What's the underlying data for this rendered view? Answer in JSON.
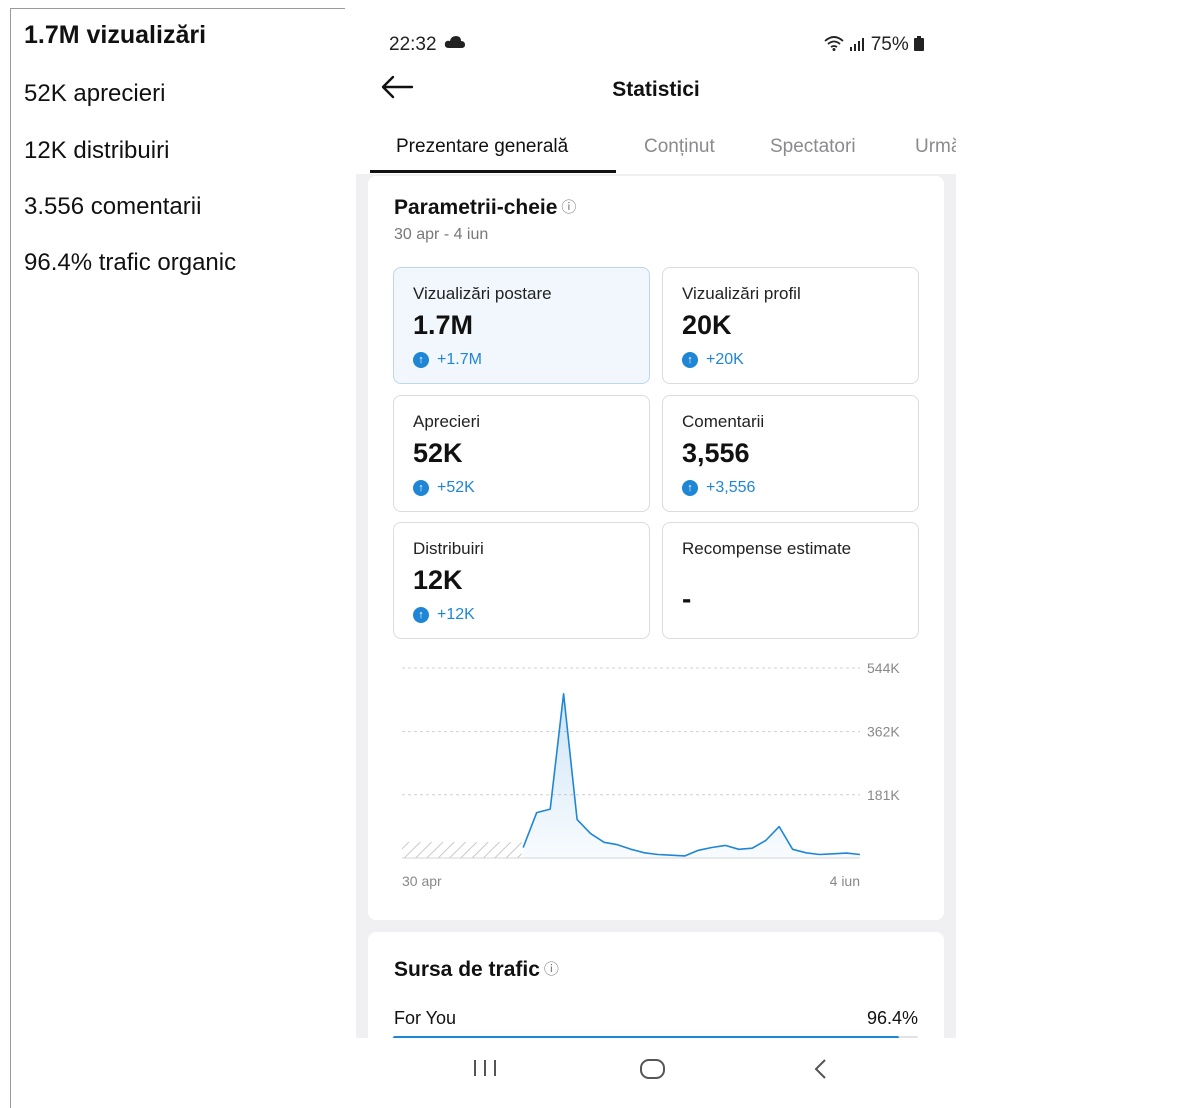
{
  "summary": {
    "views": "1.7M vizualizări",
    "likes": "52K aprecieri",
    "shares": "12K distribuiri",
    "comments": "3.556 comentarii",
    "organic": "96.4% trafic organic"
  },
  "status_bar": {
    "time": "22:32",
    "battery": "75%",
    "icons": [
      "cloud-icon",
      "wifi-icon",
      "signal-icon",
      "battery-icon"
    ]
  },
  "header": {
    "title": "Statistici",
    "back_icon": "back-arrow-icon"
  },
  "tabs": [
    {
      "label": "Prezentare generală",
      "active": true
    },
    {
      "label": "Conținut",
      "active": false
    },
    {
      "label": "Spectatori",
      "active": false
    },
    {
      "label": "Urmăritori",
      "active": false
    }
  ],
  "key_metrics": {
    "title": "Parametrii-cheie",
    "info_icon": "ⓘ",
    "date_range": "30 apr - 4 iun",
    "tiles": [
      {
        "label": "Vizualizări postare",
        "value": "1.7M",
        "delta": "+1.7M",
        "selected": true
      },
      {
        "label": "Vizualizări profil",
        "value": "20K",
        "delta": "+20K",
        "selected": false
      },
      {
        "label": "Aprecieri",
        "value": "52K",
        "delta": "+52K",
        "selected": false
      },
      {
        "label": "Comentarii",
        "value": "3,556",
        "delta": "+3,556",
        "selected": false
      },
      {
        "label": "Distribuiri",
        "value": "12K",
        "delta": "+12K",
        "selected": false
      },
      {
        "label": "Recompense estimate",
        "value": "-",
        "delta": "",
        "selected": false
      }
    ]
  },
  "chart_data": {
    "type": "area",
    "title": "",
    "xlabel": "",
    "ylabel": "",
    "x_tick_labels": [
      "30 apr",
      "4 iun"
    ],
    "y_tick_labels": [
      "544K",
      "362K",
      "181K"
    ],
    "y_ticks": [
      544000,
      362000,
      181000
    ],
    "ylim": [
      0,
      544000
    ],
    "grid": true,
    "color": "#1f86d6",
    "no_data_days": 9,
    "series": [
      {
        "values": [
          0,
          0,
          0,
          0,
          0,
          0,
          0,
          0,
          0,
          30000,
          130000,
          140000,
          470000,
          110000,
          70000,
          45000,
          38000,
          25000,
          15000,
          10000,
          8000,
          6000,
          22000,
          30000,
          36000,
          25000,
          28000,
          50000,
          90000,
          25000,
          15000,
          10000,
          12000,
          14000,
          10000
        ]
      }
    ]
  },
  "traffic": {
    "title": "Sursa de trafic",
    "info_icon": "ⓘ",
    "rows": [
      {
        "label": "For You",
        "value": "96.4%",
        "fraction": 0.964
      }
    ]
  },
  "nav": {
    "recents_icon": "recent-apps-icon",
    "home_icon": "home-icon",
    "back_icon": "back-icon"
  }
}
